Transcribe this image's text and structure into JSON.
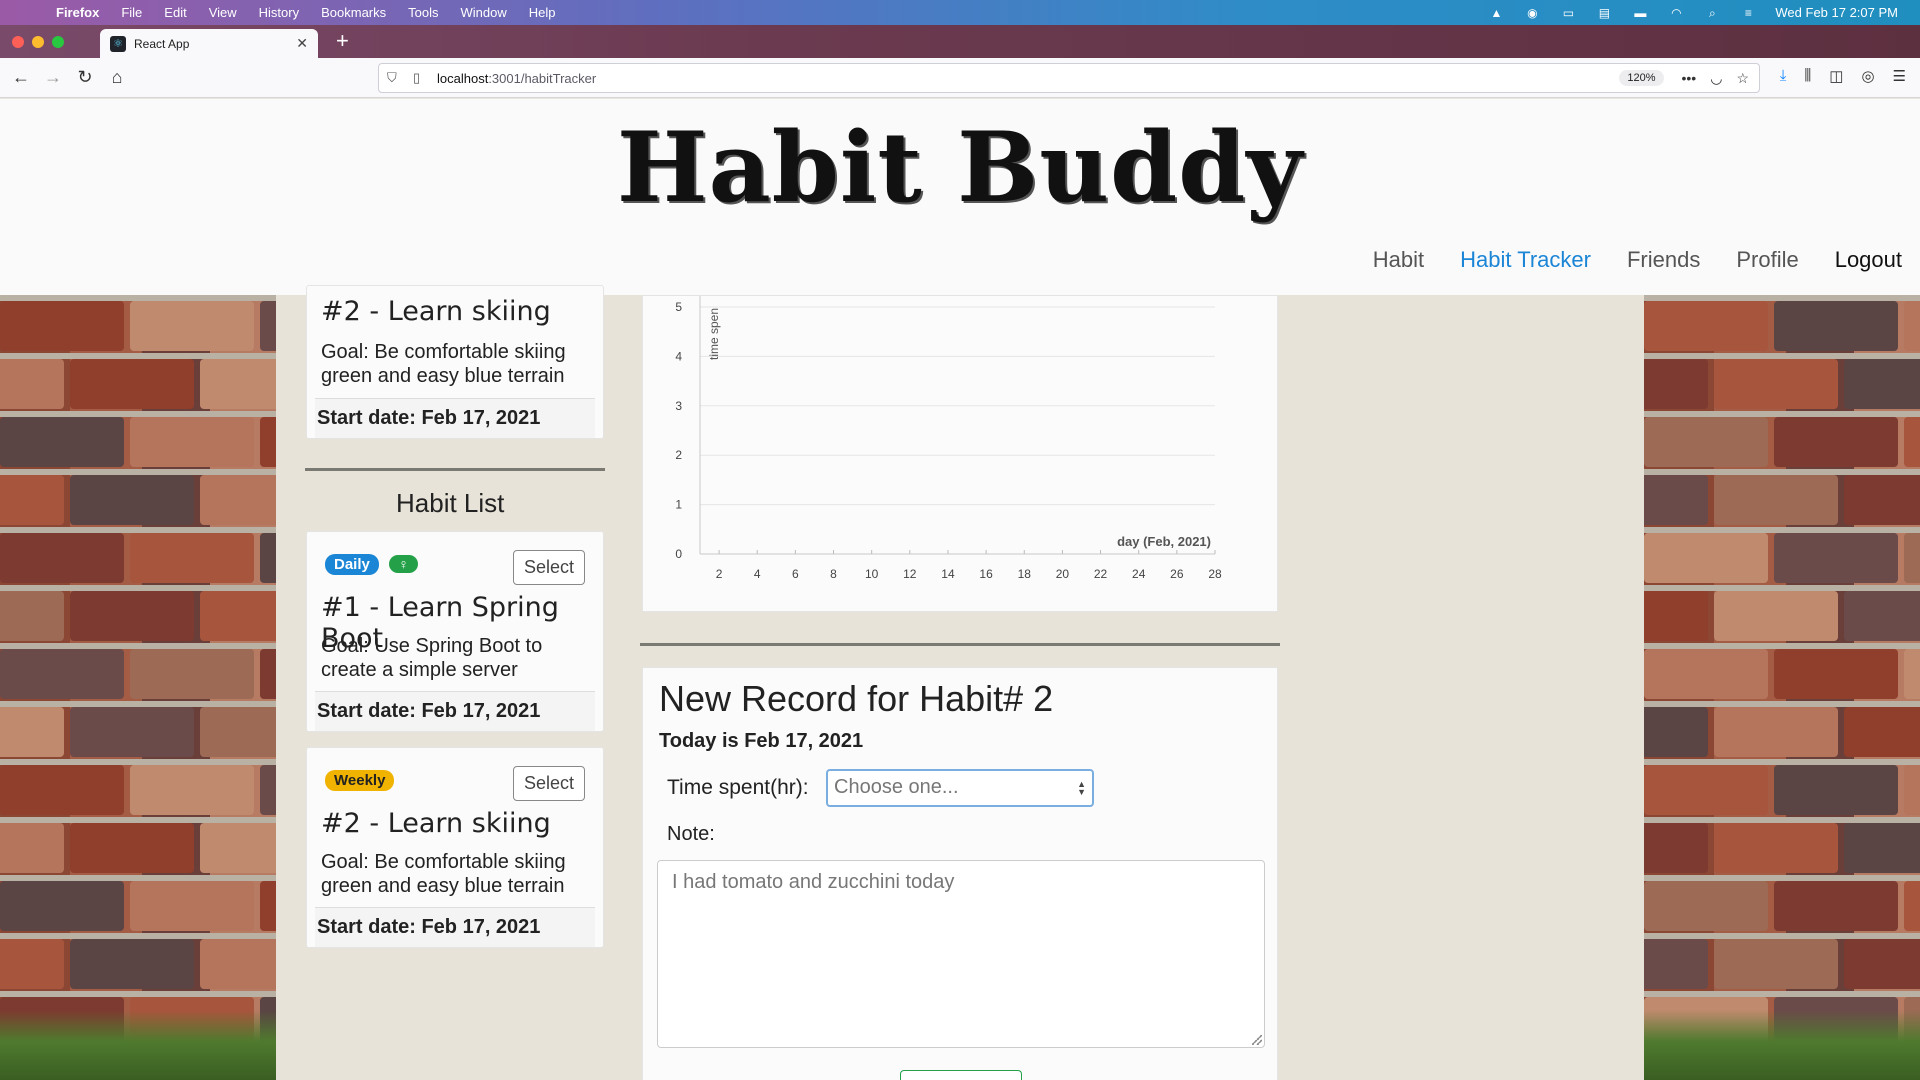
{
  "menubar": {
    "app": "Firefox",
    "items": [
      "File",
      "Edit",
      "View",
      "History",
      "Bookmarks",
      "Tools",
      "Window",
      "Help"
    ],
    "datetime": "Wed Feb 17  2:07 PM"
  },
  "browser": {
    "tab_title": "React App",
    "url_host": "localhost",
    "url_path": ":3001/habitTracker",
    "zoom": "120%"
  },
  "header": {
    "brand": "Habit Buddy",
    "nav": [
      {
        "label": "Habit"
      },
      {
        "label": "Habit Tracker",
        "active": true
      },
      {
        "label": "Friends"
      },
      {
        "label": "Profile"
      },
      {
        "label": "Logout"
      }
    ]
  },
  "selected_habit": {
    "title": "#2 - Learn skiing",
    "goal_line1": "Goal: Be comfortable skiing",
    "goal_line2": "green and easy blue terrain",
    "start": "Start date: Feb 17, 2021"
  },
  "habit_list": {
    "title": "Habit List",
    "select_label": "Select",
    "items": [
      {
        "badge": "Daily",
        "title": "#1 - Learn Spring Boot",
        "goal_line1": "Goal: Use Spring Boot to",
        "goal_line2": "create a simple server",
        "start": "Start date: Feb 17, 2021"
      },
      {
        "badge": "Weekly",
        "title": "#2 - Learn skiing",
        "goal_line1": "Goal: Be comfortable skiing",
        "goal_line2": "green and easy blue terrain",
        "start": "Start date: Feb 17, 2021"
      }
    ]
  },
  "chart_data": {
    "type": "line",
    "xlabel": "day (Feb, 2021)",
    "ylabel": "time spen",
    "x_ticks": [
      2,
      4,
      6,
      8,
      10,
      12,
      14,
      16,
      18,
      20,
      22,
      24,
      26,
      28
    ],
    "y_ticks": [
      0,
      1,
      2,
      3,
      4,
      5
    ],
    "xlim": [
      1,
      28
    ],
    "ylim": [
      0,
      5
    ],
    "series": [],
    "grid": true
  },
  "record": {
    "title": "New Record for Habit# 2",
    "today": "Today is Feb 17, 2021",
    "time_label": "Time spent(hr):",
    "time_placeholder": "Choose one...",
    "note_label": "Note:",
    "note_value": "I had tomato and zucchini today"
  },
  "colors": {
    "accent": "#1b85d6",
    "daily_badge": "#1b85d6",
    "weekly_badge": "#f0b400",
    "icon_badge": "#24a148"
  }
}
